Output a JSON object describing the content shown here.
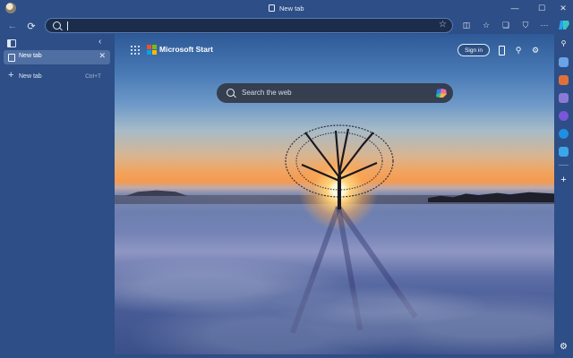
{
  "window": {
    "tab_title": "New tab",
    "controls": {
      "minimize": "—",
      "maximize": "☐",
      "close": "✕"
    }
  },
  "toolbar": {
    "back_icon": "←",
    "refresh_icon": "⟳",
    "favorite_icon": "☆",
    "address_value": "",
    "icons": {
      "split_screen": "◫",
      "favorites": "☆",
      "collections": "❏",
      "extensions": "⛉",
      "more": "···"
    }
  },
  "vertical_tabs": {
    "collapse_icon": "‹",
    "tabs": [
      {
        "label": "New tab",
        "close": "✕"
      }
    ],
    "new_tab": {
      "plus": "+",
      "label": "New tab",
      "shortcut": "Ctrl+T"
    }
  },
  "ntp": {
    "brand": "Microsoft Start",
    "sign_in": "Sign in",
    "search_placeholder": "Search the web",
    "header_icons": {
      "rewards": "⚲",
      "settings": "⚙"
    }
  },
  "sidebar": {
    "icons": [
      "search-icon",
      "shopping-icon",
      "tools-icon",
      "games-icon",
      "microsoft365-icon",
      "outlook-icon",
      "drop-icon"
    ],
    "glyphs": {
      "search": "⚲",
      "add": "+",
      "settings": "⚙"
    }
  },
  "colors": {
    "frame": "#2d4e86",
    "active_tab": "#4f6fa3",
    "address_bg": "#1c2d4c"
  }
}
